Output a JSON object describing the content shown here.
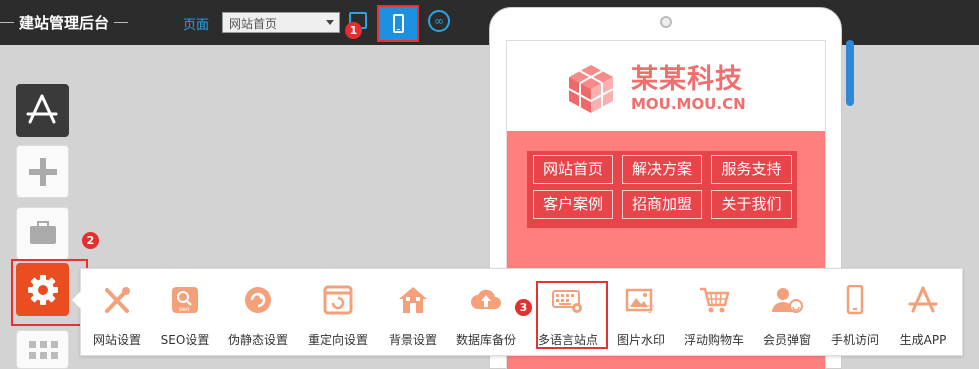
{
  "header": {
    "app_title": "建站管理后台",
    "page_label": "页面",
    "page_select_value": "网站首页"
  },
  "badges": {
    "one": "1",
    "two": "2",
    "three": "3"
  },
  "device_icons": [
    "monitor-icon",
    "mobile-phone-icon",
    "link-icon"
  ],
  "sidebar_icons": [
    "app-store-icon",
    "add-icon",
    "toolbox-icon",
    "settings-gear-icon",
    "grid-icon"
  ],
  "preview": {
    "logo_cn": "某某科技",
    "logo_en": "MOU.MOU.CN",
    "nav_items": [
      "网站首页",
      "解决方案",
      "服务支持",
      "客户案例",
      "招商加盟",
      "关于我们"
    ]
  },
  "tools": [
    {
      "label": "网站设置",
      "icon": "wrench-icon"
    },
    {
      "label": "SEO设置",
      "icon": "seo-search-icon"
    },
    {
      "label": "伪静态设置",
      "icon": "rewrite-icon"
    },
    {
      "label": "重定向设置",
      "icon": "redirect-icon"
    },
    {
      "label": "背景设置",
      "icon": "background-house-icon"
    },
    {
      "label": "数据库备份",
      "icon": "cloud-upload-icon"
    },
    {
      "label": "多语言站点",
      "icon": "language-keyboard-icon"
    },
    {
      "label": "图片水印",
      "icon": "image-watermark-icon"
    },
    {
      "label": "浮动购物车",
      "icon": "shopping-cart-icon"
    },
    {
      "label": "会员弹窗",
      "icon": "member-icon"
    },
    {
      "label": "手机访问",
      "icon": "mobile-access-icon"
    },
    {
      "label": "生成APP",
      "icon": "app-generate-icon"
    }
  ],
  "colors": {
    "accent_blue": "#2aa4e6",
    "tool_orange": "#f4a07a",
    "logo_pink": "#f26e6e",
    "highlight_red": "#e53333"
  }
}
